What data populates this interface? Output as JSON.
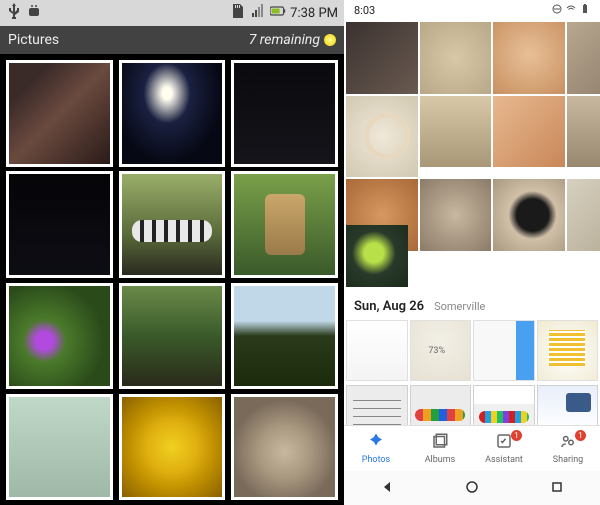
{
  "left": {
    "status": {
      "time": "7:38 PM"
    },
    "header": {
      "title": "Pictures",
      "remaining": "7 remaining"
    }
  },
  "right": {
    "status": {
      "time": "8:03"
    },
    "section": {
      "date": "Sun, Aug 26",
      "location": "Somerville"
    },
    "tabs": {
      "photos": "Photos",
      "albums": "Albums",
      "assistant": "Assistant",
      "sharing": "Sharing",
      "assistant_badge": "1",
      "sharing_badge": "1"
    }
  }
}
